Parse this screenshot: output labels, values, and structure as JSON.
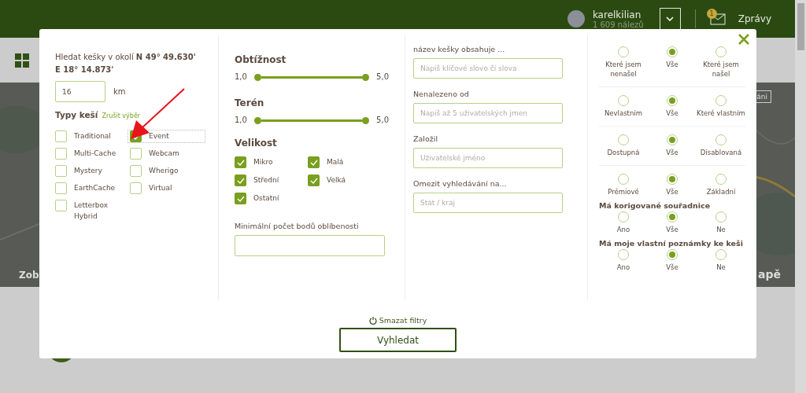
{
  "header": {
    "username": "karelkilian",
    "finds": "1 609 nálezů",
    "messages_badge": "1",
    "messages_label": "Zprávy"
  },
  "background": {
    "map_left_text": "Zob",
    "map_right_text": "apě",
    "map_button": "áni"
  },
  "filters": {
    "location": {
      "label": "Hledat kešky v okolí **N 49° 49.630' E 18° 14.873'**",
      "radius": "16",
      "unit": "km"
    },
    "types_title": "Typy keší",
    "types_clear": "Zrušit výběr",
    "types": [
      {
        "label": "Traditional",
        "checked": false,
        "focused": false
      },
      {
        "label": "Event",
        "checked": true,
        "focused": true
      },
      {
        "label": "Multi-Cache",
        "checked": false,
        "focused": false
      },
      {
        "label": "Webcam",
        "checked": false,
        "focused": false
      },
      {
        "label": "Mystery",
        "checked": false,
        "focused": false
      },
      {
        "label": "Wherigo",
        "checked": false,
        "focused": false
      },
      {
        "label": "EarthCache",
        "checked": false,
        "focused": false
      },
      {
        "label": "Virtual",
        "checked": false,
        "focused": false
      },
      {
        "label": "Letterbox Hybrid",
        "checked": false,
        "focused": false
      }
    ],
    "sliders": [
      {
        "title": "Obtížnost",
        "min_label": "1,0",
        "max_label": "5,0",
        "thumbs": [
          {
            "level": 0
          },
          {
            "level": 1
          }
        ]
      },
      {
        "title": "Terén",
        "min_label": "1,0",
        "max_label": "5,0",
        "thumbs": [
          {
            "level": 0
          },
          {
            "level": 1
          }
        ]
      }
    ],
    "size_title": "Velikost",
    "sizes": [
      {
        "label": "Mikro",
        "checked": true
      },
      {
        "label": "Malá",
        "checked": true
      },
      {
        "label": "Střední",
        "checked": true
      },
      {
        "label": "Velká",
        "checked": true
      },
      {
        "label": "Ostatní",
        "checked": true
      }
    ],
    "favorites": {
      "label": "Minimální počet bodů oblíbenosti"
    },
    "text_fields": [
      {
        "label": "název kešky obsahuje ...",
        "placeholder": "Napiš klíčové slovo či slova"
      },
      {
        "label": "Nenalezeno od",
        "placeholder": "Napiš až 5 uživatelských jmen"
      },
      {
        "label": "Založil",
        "placeholder": "Uživatelské jméno"
      },
      {
        "label": "Omezit vyhledávání na...",
        "placeholder": "Stát / kraj"
      }
    ],
    "radio_groups": [
      {
        "options": [
          {
            "label": "Které jsem nenašel",
            "selected": false
          },
          {
            "label": "Vše",
            "selected": true
          },
          {
            "label": "Které jsem našel",
            "selected": false
          }
        ]
      },
      {
        "options": [
          {
            "label": "Nevlastním",
            "selected": false
          },
          {
            "label": "Vše",
            "selected": true
          },
          {
            "label": "Které vlastním",
            "selected": false
          }
        ]
      },
      {
        "options": [
          {
            "label": "Dostupná",
            "selected": false
          },
          {
            "label": "Vše",
            "selected": true
          },
          {
            "label": "Disablovaná",
            "selected": false
          }
        ]
      },
      {
        "options": [
          {
            "label": "Prémiové",
            "selected": false
          },
          {
            "label": "Vše",
            "selected": true
          },
          {
            "label": "Základní",
            "selected": false
          }
        ]
      },
      {
        "title": "Má korigované souřadnice",
        "options": [
          {
            "label": "Ano",
            "selected": false
          },
          {
            "label": "Vše",
            "selected": true
          },
          {
            "label": "Ne",
            "selected": false
          }
        ]
      },
      {
        "title": "Má moje vlastní poznámky ke keši",
        "options": [
          {
            "label": "Ano",
            "selected": false
          },
          {
            "label": "Vše",
            "selected": true
          },
          {
            "label": "Ne",
            "selected": false
          }
        ]
      }
    ],
    "clear_label": "Smazat filtry",
    "search_button": "Vyhledat"
  }
}
